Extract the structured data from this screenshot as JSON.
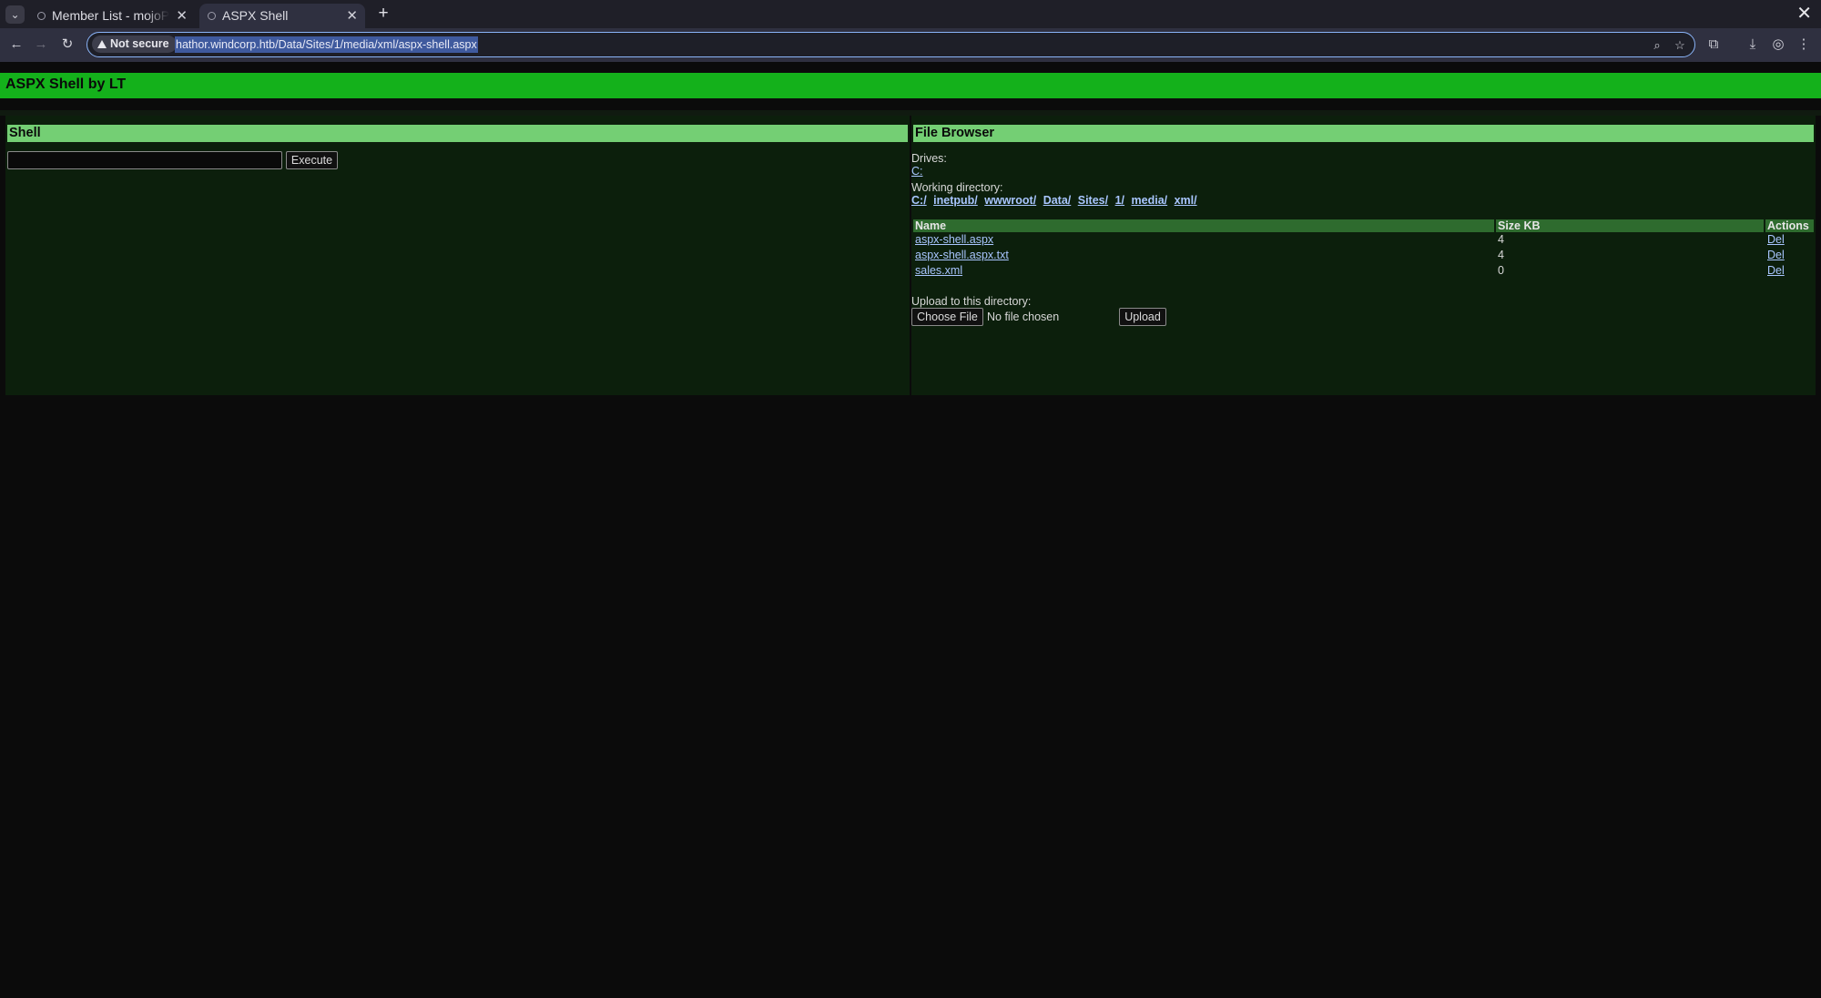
{
  "browser": {
    "tabs": [
      {
        "title": "Member List - mojoPortal",
        "active": false
      },
      {
        "title": "ASPX Shell",
        "active": true
      }
    ],
    "new_tab_label": "+",
    "close_glyph": "✕",
    "window_close_glyph": "✕",
    "security_chip": "Not secure",
    "url": "hathor.windcorp.htb/Data/Sites/1/media/xml/aspx-shell.aspx",
    "icons": {
      "tab_search": "chevron-down-icon",
      "back": "back-arrow-icon",
      "forward": "forward-arrow-icon",
      "reload": "reload-icon",
      "zoom": "zoom-icon",
      "bookmark": "star-icon",
      "extensions": "puzzle-icon",
      "downloads": "download-icon",
      "profile": "profile-icon",
      "menu": "kebab-menu-icon"
    }
  },
  "page": {
    "banner_title": "ASPX Shell by LT",
    "colors": {
      "banner": "#14b11b",
      "panel": "#0c1f0c",
      "panel_head": "#74cf74",
      "table_head": "#2e6b2e",
      "link": "#a9c6ff"
    },
    "shell": {
      "heading": "Shell",
      "command_value": "",
      "execute_label": "Execute"
    },
    "file_browser": {
      "heading": "File Browser",
      "drives_label": "Drives:",
      "drives": [
        "C:"
      ],
      "working_dir_label": "Working directory:",
      "path_parts": [
        "C:/",
        "inetpub/",
        "wwwroot/",
        "Data/",
        "Sites/",
        "1/",
        "media/",
        "xml/"
      ],
      "columns": [
        "Name",
        "Size KB",
        "Actions"
      ],
      "files": [
        {
          "name": "aspx-shell.aspx",
          "size": "4",
          "action": "Del"
        },
        {
          "name": "aspx-shell.aspx.txt",
          "size": "4",
          "action": "Del"
        },
        {
          "name": "sales.xml",
          "size": "0",
          "action": "Del"
        }
      ],
      "upload_label": "Upload to this directory:",
      "choose_file_label": "Choose File",
      "no_file_text": "No file chosen",
      "upload_button_label": "Upload"
    }
  }
}
